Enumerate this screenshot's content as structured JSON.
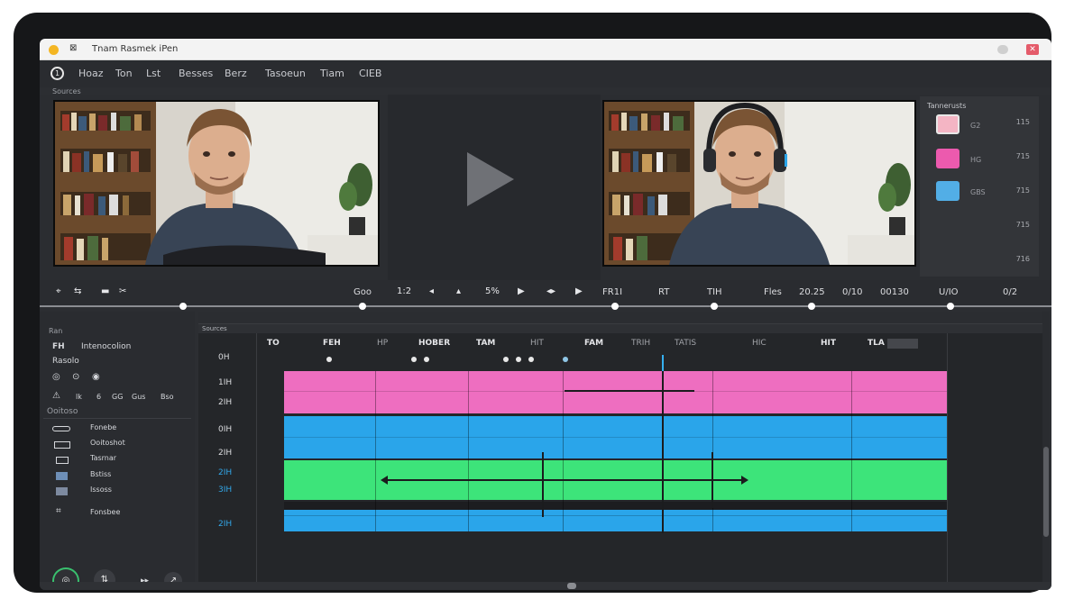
{
  "window": {
    "title": "Tnam Rasmek iPen",
    "close_glyph": "✕"
  },
  "menu": [
    "Hoaz",
    "Ton",
    "Lst",
    "Besses",
    "Berz",
    "Tasoeun",
    "Tiam",
    "CIEB"
  ],
  "sources_label": "Sources",
  "swatches": {
    "title": "Tannerusts",
    "items": [
      {
        "color": "#f4b5c4",
        "label": "G2",
        "value": "115"
      },
      {
        "color": "#ec5aae",
        "label": "HG",
        "value": "715"
      },
      {
        "color": "#52aee6",
        "label": "GBS",
        "value": "715"
      }
    ],
    "extra_values": [
      "715",
      "716"
    ]
  },
  "transport": {
    "left_icons": [
      "⌖",
      "⇆",
      "▬",
      "✂"
    ],
    "center_label": "Goo",
    "buttons": [
      "1:2",
      "◂",
      "▴",
      "5%",
      "▶",
      "◂▸",
      "▶"
    ],
    "right_labels": [
      "FR1I",
      "RT",
      "TIH",
      "Fles",
      "20.25",
      "0/10",
      "00130",
      "U/IO",
      "0/2"
    ]
  },
  "left_panel": {
    "header": "Ran",
    "title_abbr": "FH",
    "title": "Intenocolion",
    "subtitle": "Rasolo",
    "icon_row_1": [
      "◎",
      "⊙",
      "◉"
    ],
    "icon_row_2": [
      "⚠",
      "lk",
      "6",
      "GG",
      "Gus",
      "Bso"
    ],
    "section": "Ooitoso",
    "items": [
      "Fonebe",
      "Ooitoshot",
      "Tasrnar",
      "Bstiss",
      "Issoss"
    ],
    "footer_item": "Fonsbee"
  },
  "timeline": {
    "header_label": "Sources",
    "ruler": [
      {
        "text": "TO",
        "dim": false
      },
      {
        "text": "FEH",
        "dim": false
      },
      {
        "text": "HP",
        "dim": true
      },
      {
        "text": "HOBER",
        "dim": false
      },
      {
        "text": "TAM",
        "dim": false
      },
      {
        "text": "HIT",
        "dim": true
      },
      {
        "text": "FAM",
        "dim": false
      },
      {
        "text": "TRIH",
        "dim": true
      },
      {
        "text": "TATIS",
        "dim": true
      },
      {
        "text": "HIC",
        "dim": true
      },
      {
        "text": "HIT",
        "dim": false
      },
      {
        "text": "TLA",
        "dim": false
      }
    ],
    "row_labels": [
      "0H",
      "1IH",
      "2IH",
      "0IH",
      "2IH",
      "2IH",
      "3IH",
      "2IH"
    ],
    "colors": {
      "pink": "#ee6ec0",
      "blue": "#2aa5ea",
      "green": "#3de47a",
      "playhead": "#35b0ef"
    }
  }
}
